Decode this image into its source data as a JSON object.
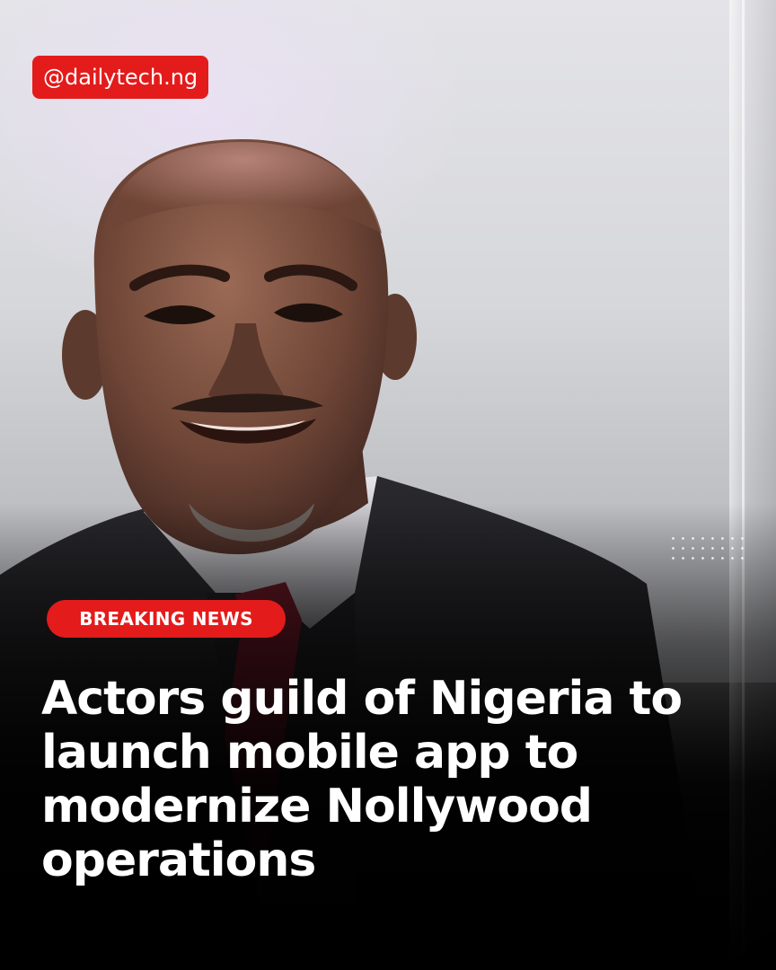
{
  "post": {
    "handle": "@dailytech.ng",
    "badge": "BREAKING NEWS",
    "headline": "Actors guild of Nigeria to launch mobile app to modernize Nollywood operations"
  },
  "colors": {
    "accent_red": "#e41b1b",
    "text": "#ffffff",
    "background_bottom": "#000000"
  },
  "icons": [
    "dot-grid-decoration"
  ]
}
